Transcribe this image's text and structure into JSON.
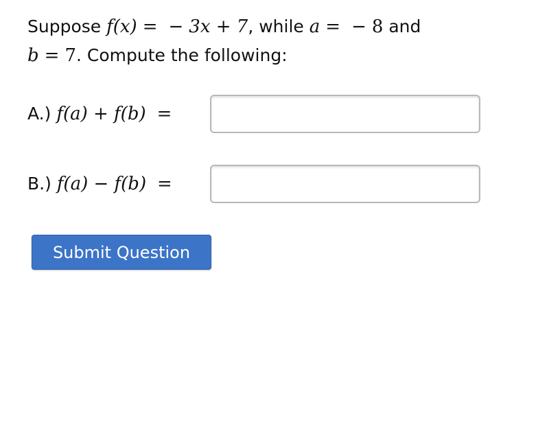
{
  "problem": {
    "intro": "Suppose ",
    "fx": "f(x)",
    "eq1": "=",
    "rhs_neg": "−",
    "rhs": "3x + 7",
    "while_text": ", while ",
    "a_var": "a",
    "eq2": "=",
    "a_neg": "−",
    "a_val": "8",
    "and_text": " and",
    "b_var": "b",
    "eq3": "=",
    "b_val": "7",
    "tail": ". Compute the following:"
  },
  "questions": [
    {
      "prefix": "A.)",
      "expression": "f(a) + f(b)",
      "equals": "=",
      "value": "",
      "placeholder": ""
    },
    {
      "prefix": "B.)",
      "expression": "f(a) − f(b)",
      "equals": "=",
      "value": "",
      "placeholder": ""
    }
  ],
  "submit": {
    "label": "Submit Question",
    "color": "#3c74c8"
  }
}
